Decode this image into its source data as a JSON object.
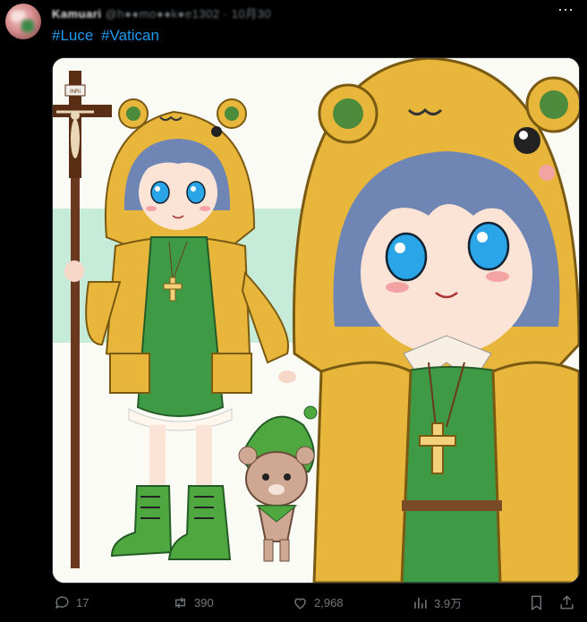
{
  "post": {
    "author_name": "Kamuari",
    "author_handle": "@h●●mo●●k●e1302",
    "time": "· 10月30",
    "hashtags": [
      "#Luce",
      "#Vatican"
    ]
  },
  "image": {
    "cross_sign": "INRI"
  },
  "actions": {
    "replies": "17",
    "reposts": "390",
    "likes": "2,968",
    "views": "3.9万"
  },
  "icons": {
    "more": "more-icon",
    "reply": "reply-icon",
    "repost": "repost-icon",
    "like": "heart-icon",
    "views": "views-icon",
    "bookmark": "bookmark-icon",
    "share": "share-icon"
  },
  "colors": {
    "background": "#000000",
    "link": "#1d9bf0",
    "muted": "#71767b",
    "raincoat": "#e7b63a",
    "dress": "#3f9a45",
    "hair": "#6f86b5",
    "eyes": "#2aa6e8"
  }
}
